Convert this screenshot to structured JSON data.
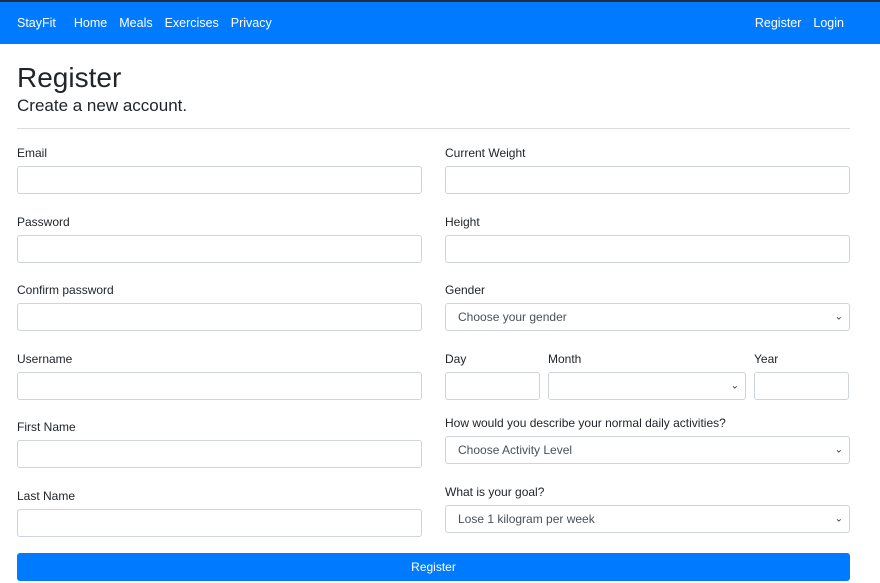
{
  "navbar": {
    "brand": "StayFit",
    "links": [
      "Home",
      "Meals",
      "Exercises",
      "Privacy"
    ],
    "right_links": [
      "Register",
      "Login"
    ]
  },
  "page": {
    "title": "Register",
    "subtitle": "Create a new account."
  },
  "form": {
    "left": {
      "email_label": "Email",
      "password_label": "Password",
      "confirm_password_label": "Confirm password",
      "username_label": "Username",
      "first_name_label": "First Name",
      "last_name_label": "Last Name"
    },
    "right": {
      "current_weight_label": "Current Weight",
      "height_label": "Height",
      "gender_label": "Gender",
      "gender_value": "Choose your gender",
      "day_label": "Day",
      "month_label": "Month",
      "year_label": "Year",
      "activity_label": "How would you describe your normal daily activities?",
      "activity_value": "Choose Activity Level",
      "goal_label": "What is your goal?",
      "goal_value": "Lose 1 kilogram per week"
    },
    "submit_label": "Register"
  },
  "colors": {
    "primary": "#007bff",
    "border": "#ced4da",
    "text": "#212529"
  }
}
